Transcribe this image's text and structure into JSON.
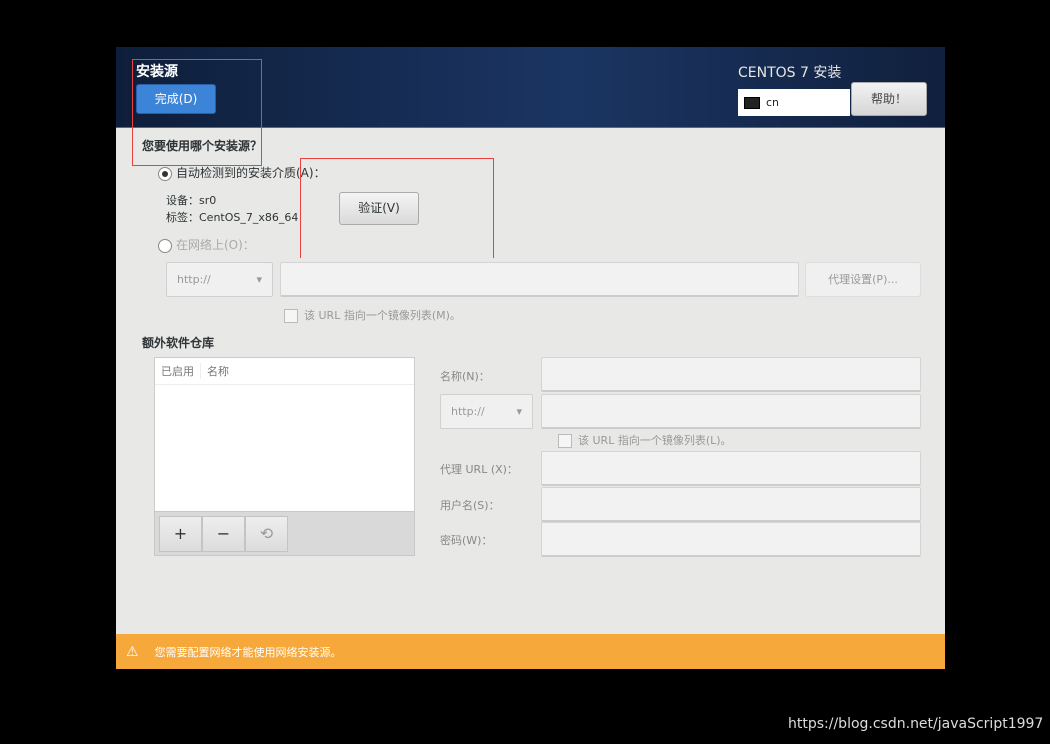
{
  "header": {
    "title": "安装源",
    "done_label": "完成(D)",
    "product_title": "CENTOS 7 安装",
    "keyboard_layout": "cn",
    "help_label": "帮助！"
  },
  "source": {
    "question": "您要使用哪个安装源？",
    "auto_label": "自动检测到的安装介质(A)：",
    "auto_selected": true,
    "device_line": "设备：sr0",
    "label_line": "标签：CentOS_7_x86_64",
    "verify_label": "验证(V)",
    "network_label": "在网络上(O)：",
    "network_selected": false,
    "protocol": "http://",
    "url_value": "",
    "proxy_label": "代理设置(P)...",
    "mirrorlist_label": "该 URL 指向一个镜像列表(M)。",
    "mirrorlist_checked": false
  },
  "repos": {
    "title": "额外软件仓库",
    "columns": [
      "已启用",
      "名称"
    ],
    "rows": [],
    "add_label": "+",
    "remove_label": "−",
    "reset_icon": "revert-icon"
  },
  "repo_form": {
    "name_label": "名称(N)：",
    "name_value": "",
    "protocol": "http://",
    "url_value": "",
    "mirrorlist_label": "该 URL 指向一个镜像列表(L)。",
    "mirrorlist_checked": false,
    "proxy_url_label": "代理 URL (X)：",
    "username_label": "用户名(S)：",
    "password_label": "密码(W)："
  },
  "warning": {
    "icon": "warning-icon",
    "text": "您需要配置网络才能使用网络安装源。",
    "color": "#f6a83b"
  },
  "watermark": "https://blog.csdn.net/javaScript1997",
  "colors": {
    "header": "#1b3563",
    "done_button": "#3c84d8",
    "annotation": "#e94040"
  }
}
